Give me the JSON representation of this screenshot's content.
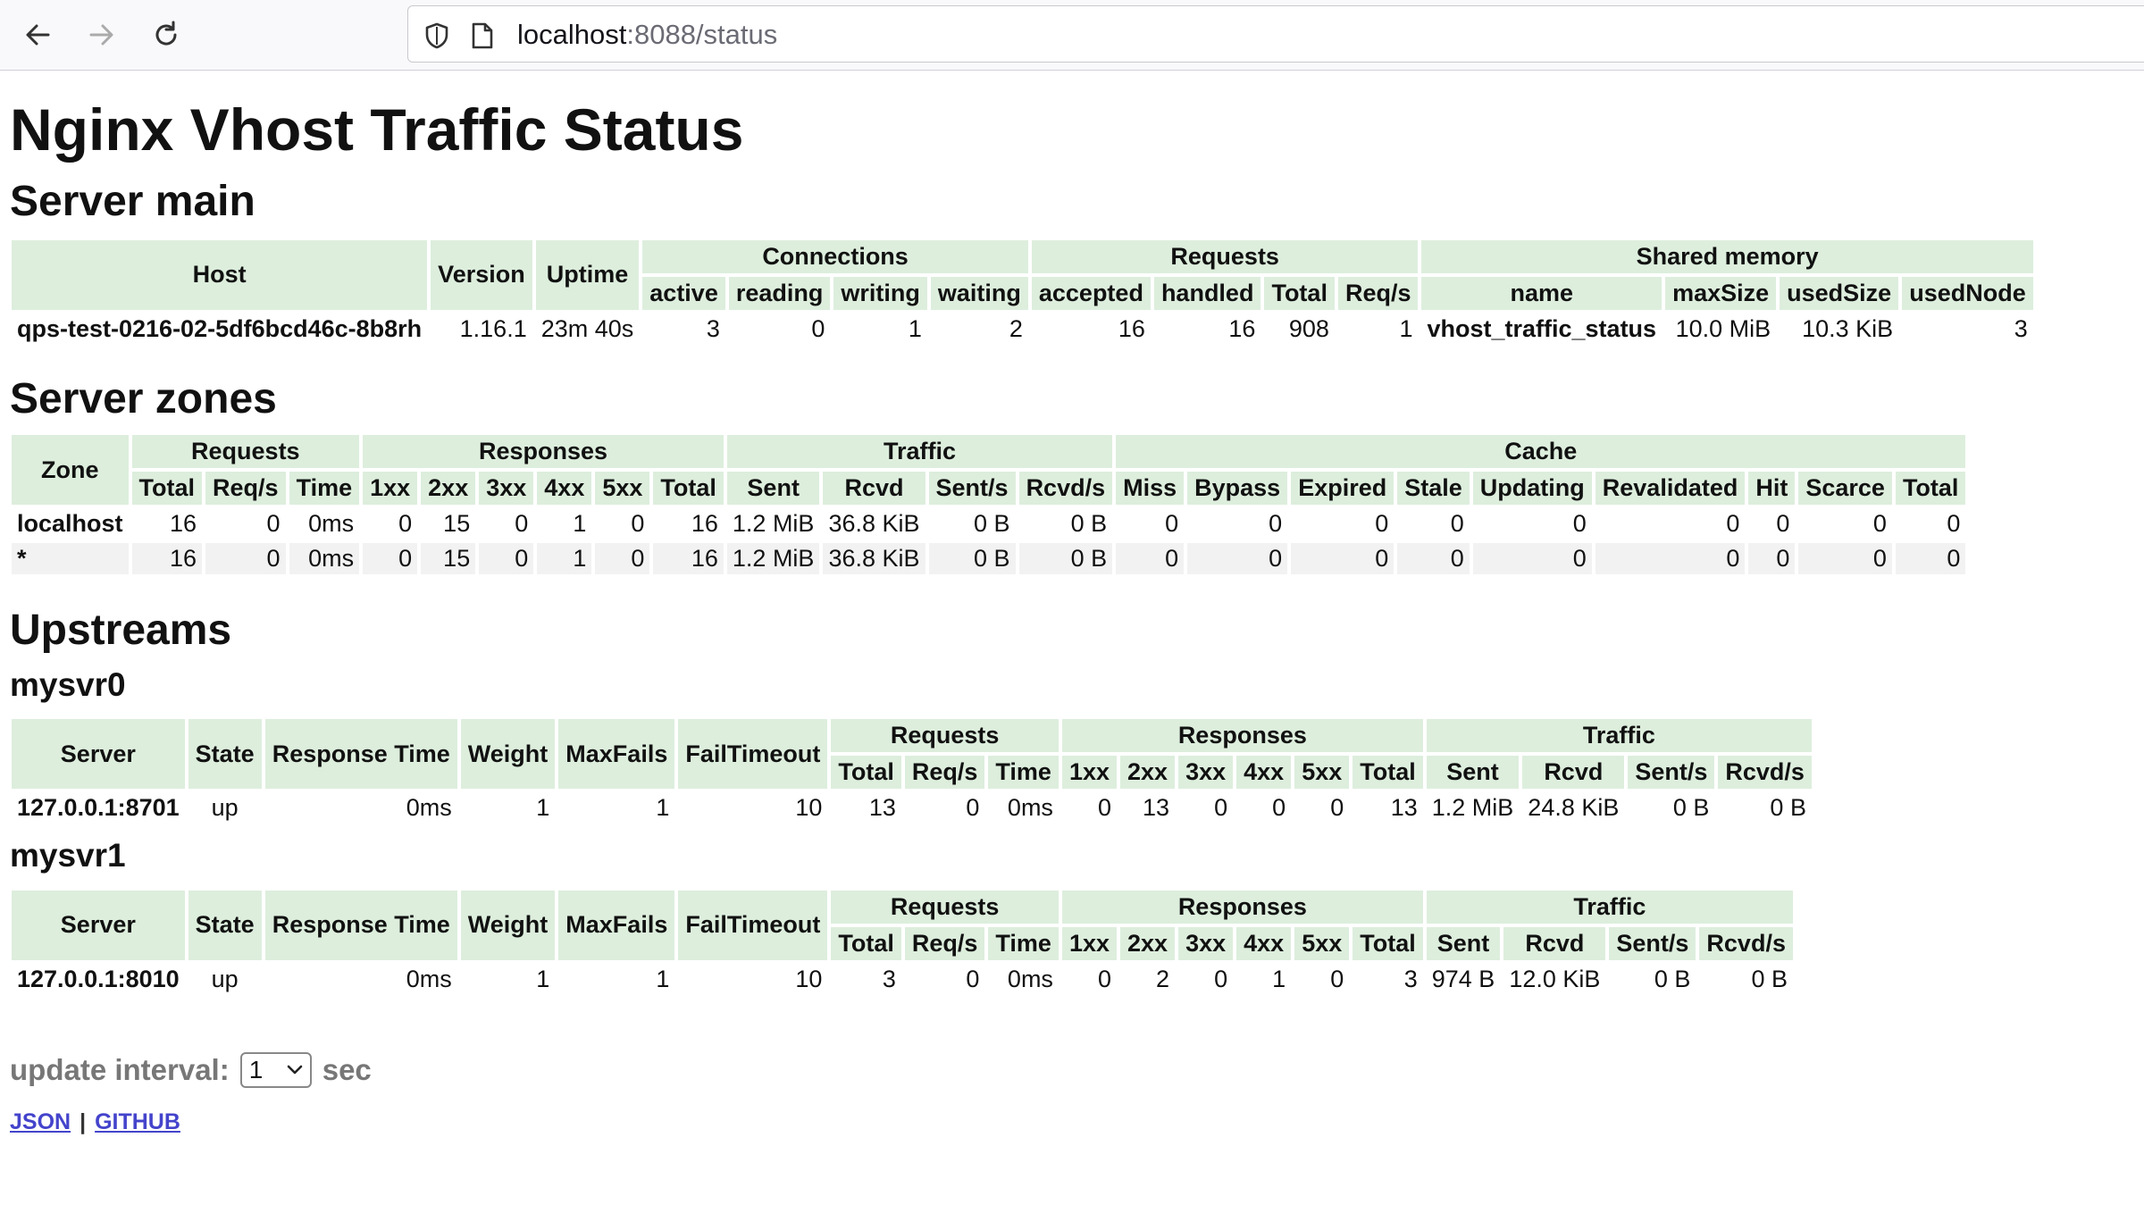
{
  "browser": {
    "url_host": "localhost",
    "url_path": ":8088/status"
  },
  "page": {
    "title": "Nginx Vhost Traffic Status"
  },
  "server_main": {
    "heading": "Server main",
    "group_headers": [
      "Connections",
      "Requests",
      "Shared memory"
    ],
    "headers": {
      "host": "Host",
      "version": "Version",
      "uptime": "Uptime"
    },
    "sub_headers": [
      "active",
      "reading",
      "writing",
      "waiting",
      "accepted",
      "handled",
      "Total",
      "Req/s",
      "name",
      "maxSize",
      "usedSize",
      "usedNode"
    ],
    "row": [
      "qps-test-0216-02-5df6bcd46c-8b8rh",
      "1.16.1",
      "23m 40s",
      "3",
      "0",
      "1",
      "2",
      "16",
      "16",
      "908",
      "1",
      "vhost_traffic_status",
      "10.0 MiB",
      "10.3 KiB",
      "3"
    ]
  },
  "server_zones": {
    "heading": "Server zones",
    "zone_header": "Zone",
    "group_headers": [
      "Requests",
      "Responses",
      "Traffic",
      "Cache"
    ],
    "sub_headers": [
      "Total",
      "Req/s",
      "Time",
      "1xx",
      "2xx",
      "3xx",
      "4xx",
      "5xx",
      "Total",
      "Sent",
      "Rcvd",
      "Sent/s",
      "Rcvd/s",
      "Miss",
      "Bypass",
      "Expired",
      "Stale",
      "Updating",
      "Revalidated",
      "Hit",
      "Scarce",
      "Total"
    ],
    "rows": [
      [
        "localhost",
        "16",
        "0",
        "0ms",
        "0",
        "15",
        "0",
        "1",
        "0",
        "16",
        "1.2 MiB",
        "36.8 KiB",
        "0 B",
        "0 B",
        "0",
        "0",
        "0",
        "0",
        "0",
        "0",
        "0",
        "0",
        "0"
      ],
      [
        "*",
        "16",
        "0",
        "0ms",
        "0",
        "15",
        "0",
        "1",
        "0",
        "16",
        "1.2 MiB",
        "36.8 KiB",
        "0 B",
        "0 B",
        "0",
        "0",
        "0",
        "0",
        "0",
        "0",
        "0",
        "0",
        "0"
      ]
    ]
  },
  "upstreams": {
    "heading": "Upstreams",
    "headers": {
      "server": "Server",
      "state": "State",
      "response_time": "Response Time",
      "weight": "Weight",
      "maxfails": "MaxFails",
      "failtimeout": "FailTimeout"
    },
    "group_headers": [
      "Requests",
      "Responses",
      "Traffic"
    ],
    "sub_headers": [
      "Total",
      "Req/s",
      "Time",
      "1xx",
      "2xx",
      "3xx",
      "4xx",
      "5xx",
      "Total",
      "Sent",
      "Rcvd",
      "Sent/s",
      "Rcvd/s"
    ],
    "groups": [
      {
        "name": "mysvr0",
        "row": [
          "127.0.0.1:8701",
          "up",
          "0ms",
          "1",
          "1",
          "10",
          "13",
          "0",
          "0ms",
          "0",
          "13",
          "0",
          "0",
          "0",
          "13",
          "1.2 MiB",
          "24.8 KiB",
          "0 B",
          "0 B"
        ]
      },
      {
        "name": "mysvr1",
        "row": [
          "127.0.0.1:8010",
          "up",
          "0ms",
          "1",
          "1",
          "10",
          "3",
          "0",
          "0ms",
          "0",
          "2",
          "0",
          "1",
          "0",
          "3",
          "974 B",
          "12.0 KiB",
          "0 B",
          "0 B"
        ]
      }
    ]
  },
  "footer": {
    "update_label": "update interval:",
    "interval_value": "1",
    "unit": "sec",
    "links": {
      "json": "JSON",
      "separator": "|",
      "github": "GITHUB"
    }
  }
}
